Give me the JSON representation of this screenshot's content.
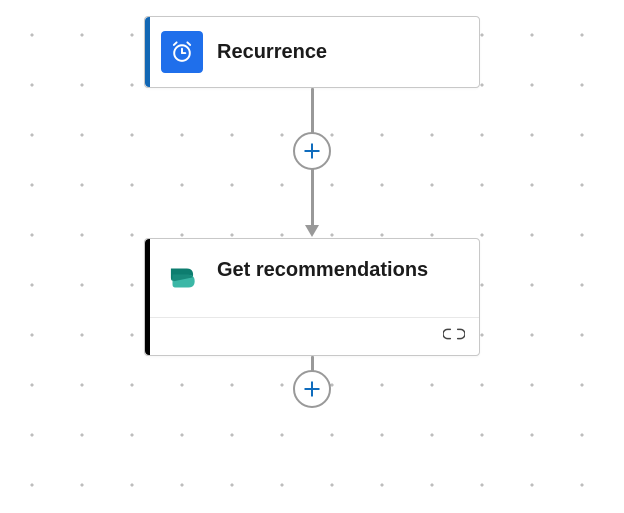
{
  "nodes": {
    "trigger": {
      "title": "Recurrence",
      "accent_color": "#1267b4",
      "icon_bg": "#1F6FEB",
      "icon": "clock-alarm"
    },
    "action": {
      "title": "Get recommendations",
      "accent_color": "#000000",
      "icon_bg": "#ffffff",
      "icon": "power-platform"
    }
  },
  "connector": {
    "add_label": "Add",
    "color": "#999999"
  }
}
